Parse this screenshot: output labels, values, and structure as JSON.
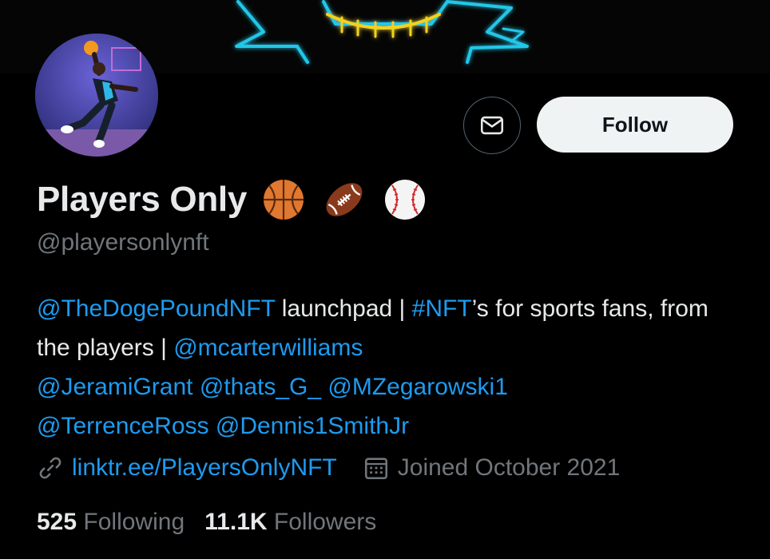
{
  "profile": {
    "display_name": "Players Only",
    "name_emojis": [
      "basketball-emoji",
      "football-emoji",
      "baseball-emoji"
    ],
    "handle": "@playersonlynft"
  },
  "actions": {
    "message_icon": "envelope-icon",
    "follow_label": "Follow"
  },
  "bio": {
    "mention_dogepound": "@TheDogePoundNFT",
    "text_launchpad": " launchpad | ",
    "hashtag_nft": "#NFT",
    "text_fans": "’s for sports fans, from the players | ",
    "mention_mcarter": "@mcarterwilliams",
    "mention_jerami": "@JeramiGrant",
    "mention_thatsg": "@thats_G_",
    "mention_mzegarowski": "@MZegarowski1",
    "mention_terrence": "@TerrenceRoss",
    "mention_dennis": "@Dennis1SmithJr"
  },
  "meta": {
    "link_icon": "link-icon",
    "link": "linktr.ee/PlayersOnlyNFT",
    "calendar_icon": "calendar-icon",
    "joined": "Joined October 2021"
  },
  "stats": {
    "following_count": "525",
    "following_label": "Following",
    "followers_count": "11.1K",
    "followers_label": "Followers"
  },
  "colors": {
    "link_blue": "#1d9bf0",
    "muted_gray": "#71767b",
    "follow_bg": "#eff3f4",
    "neon_cyan": "#22c7e8",
    "neon_yellow": "#f3d21a"
  }
}
